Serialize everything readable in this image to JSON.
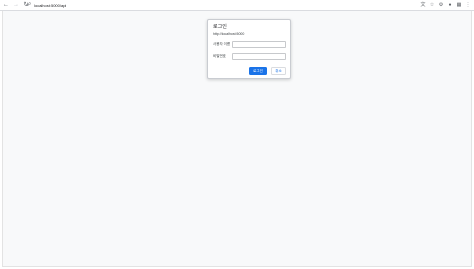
{
  "browser": {
    "back_icon": "back-arrow-icon",
    "forward_icon": "forward-arrow-icon",
    "reload_icon": "reload-icon",
    "site_info_icon": "site-info-icon",
    "url": "localhost:5000/api",
    "right_icons": [
      "translate-icon",
      "bookmark-star-icon",
      "extensions-icon",
      "profile-icon",
      "sidebar-icon",
      "menu-icon"
    ]
  },
  "dialog": {
    "title": "로그인",
    "origin": "http://localhost:5000",
    "username_label": "사용자 이름",
    "username_value": "",
    "password_label": "비밀번호",
    "password_value": "",
    "login_button": "로그인",
    "cancel_button": "취소"
  },
  "colors": {
    "accent": "#1a73e8",
    "page_background": "#f8f9fa"
  }
}
